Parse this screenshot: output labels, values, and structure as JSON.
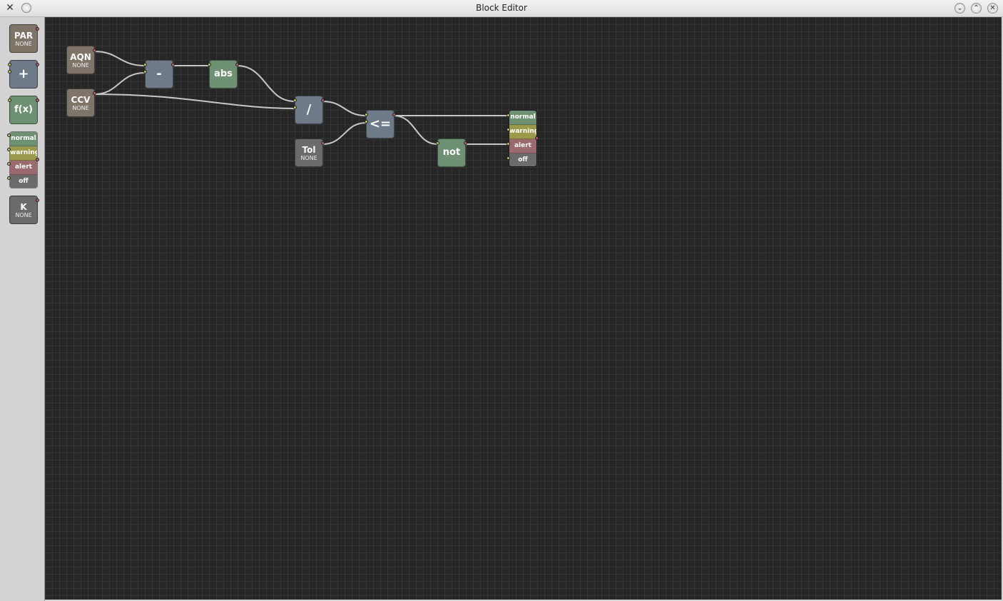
{
  "window": {
    "title": "Block Editor",
    "app_icon": "x-icon"
  },
  "palette": {
    "par": {
      "name": "PAR",
      "value": "NONE"
    },
    "add": {
      "symbol": "+"
    },
    "func": {
      "label": "f(x)"
    },
    "status": [
      "normal",
      "warning",
      "alert",
      "off"
    ],
    "const": {
      "name": "K",
      "value": "NONE"
    }
  },
  "canvas": {
    "aqn": {
      "name": "AQN",
      "value": "NONE"
    },
    "ccv": {
      "name": "CCV",
      "value": "NONE"
    },
    "tol": {
      "name": "Tol",
      "value": "NONE"
    },
    "minus": {
      "symbol": "-"
    },
    "abs": {
      "label": "abs"
    },
    "divide": {
      "symbol": "/"
    },
    "lte": {
      "symbol": "<="
    },
    "not": {
      "label": "not"
    },
    "status": [
      "normal",
      "warning",
      "alert",
      "off"
    ]
  },
  "colors": {
    "canvas_bg": "#262626",
    "parameter_block": "#7e7468",
    "operator_block": "#6e7a88",
    "function_block": "#6f9173",
    "constant_block": "#6b6b6b",
    "output_port": "#d0585c",
    "input_port": "#b9c260",
    "wire": "#c8c8c8"
  }
}
